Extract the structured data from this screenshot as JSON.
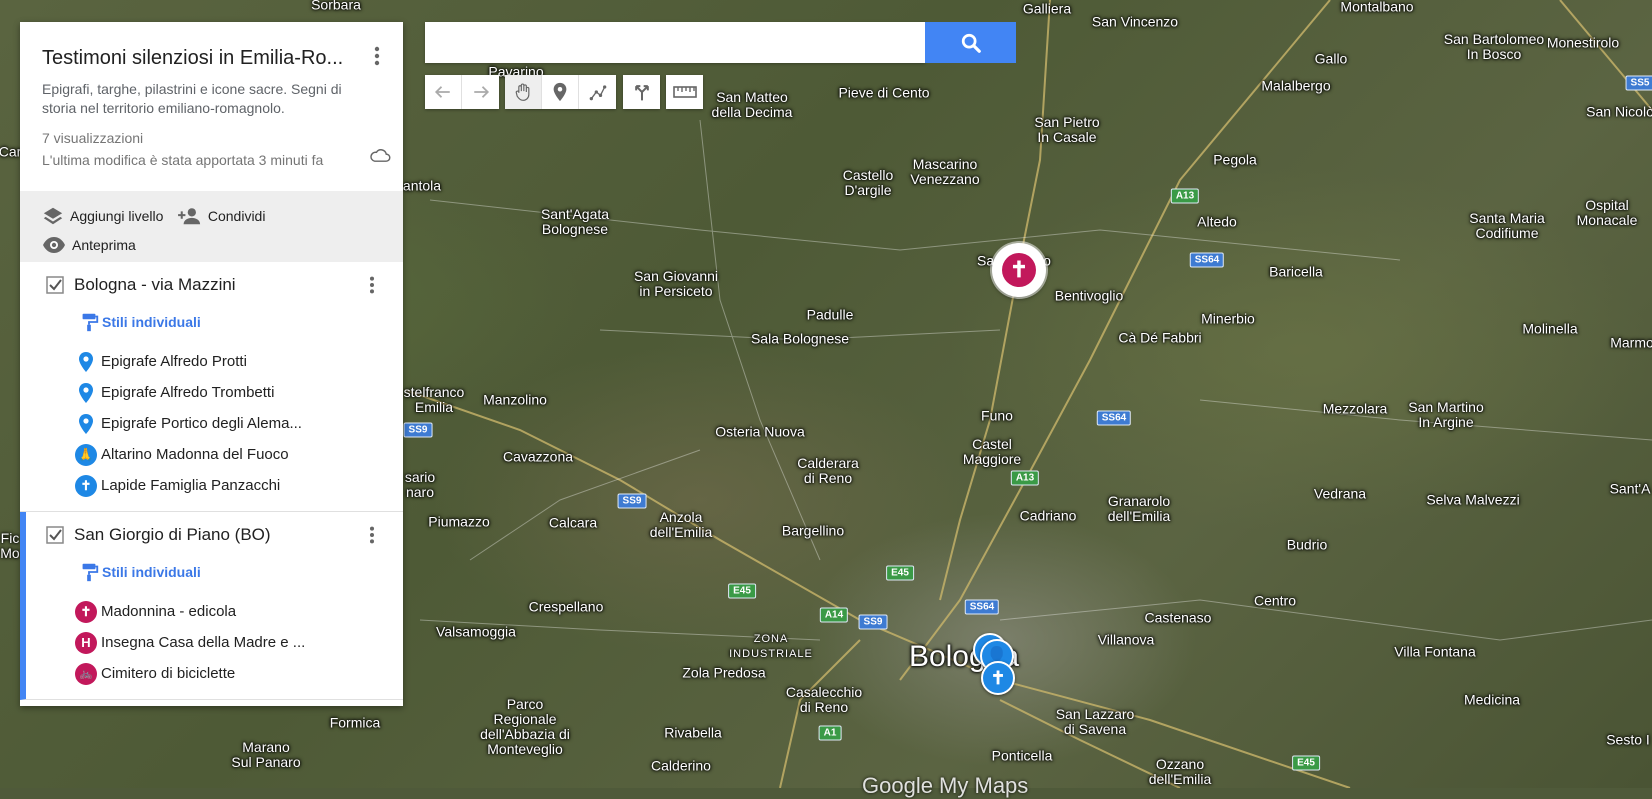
{
  "search": {
    "placeholder": "",
    "value": ""
  },
  "panel": {
    "title": "Testimoni silenziosi in Emilia-Ro...",
    "description": "Epigrafi, targhe, pilastrini e icone sacre. Segni di storia nel territorio emiliano-romagnolo.",
    "views": "7 visualizzazioni",
    "last_edit": "L'ultima modifica è stata apportata 3 minuti fa",
    "actions": {
      "add_layer": "Aggiungi livello",
      "share": "Condividi",
      "preview": "Anteprima"
    }
  },
  "layers": [
    {
      "name": "Bologna - via Mazzini",
      "styles_label": "Stili individuali",
      "features": [
        {
          "label": "Epigrafe Alfredo Protti",
          "icon": "pin-icon"
        },
        {
          "label": "Epigrafe Alfredo Trombetti",
          "icon": "pin-icon"
        },
        {
          "label": "Epigrafe Portico degli Alema...",
          "icon": "pin-icon"
        },
        {
          "label": "Altarino Madonna del Fuoco",
          "icon": "praying-icon"
        },
        {
          "label": "Lapide Famiglia Panzacchi",
          "icon": "cross-icon"
        }
      ]
    },
    {
      "name": "San Giorgio di Piano (BO)",
      "styles_label": "Stili individuali",
      "features": [
        {
          "label": "Madonnina - edicola",
          "icon": "cross-icon"
        },
        {
          "label": "Insegna Casa della Madre e ...",
          "icon": "h-icon"
        },
        {
          "label": "Cimitero di biciclette",
          "icon": "bicycle-icon"
        }
      ]
    }
  ],
  "map": {
    "places": [
      {
        "name": "Sorbara"
      },
      {
        "name": "Galliera"
      },
      {
        "name": "San Vincenzo"
      },
      {
        "name": "Montalbano"
      },
      {
        "name": "San Bartolomeo\nIn Bosco"
      },
      {
        "name": "Monestirolo"
      },
      {
        "name": "Gallo"
      },
      {
        "name": "Malalbergo"
      },
      {
        "name": "San Nicolò"
      },
      {
        "name": "Pavarino"
      },
      {
        "name": "San Matteo\ndella Decima"
      },
      {
        "name": "Pieve di Cento"
      },
      {
        "name": "San Pietro\nIn Casale"
      },
      {
        "name": "Pegola"
      },
      {
        "name": "Castello\nD'argile"
      },
      {
        "name": "Mascarino\nVenezzano"
      },
      {
        "name": "antola"
      },
      {
        "name": "Sant'Agata\nBolognese"
      },
      {
        "name": "Altedo"
      },
      {
        "name": "Santa Maria\nCodifiume"
      },
      {
        "name": "Ospital\nMonacale"
      },
      {
        "name": "San Giovanni\nin Persiceto"
      },
      {
        "name": "San Giorgio"
      },
      {
        "name": "Baricella"
      },
      {
        "name": "Bentivoglio"
      },
      {
        "name": "Padulle"
      },
      {
        "name": "Minerbio"
      },
      {
        "name": "Sala Bolognese"
      },
      {
        "name": "Cà Dé Fabbri"
      },
      {
        "name": "Molinella"
      },
      {
        "name": "Marmo"
      },
      {
        "name": "stelfranco\nEmilia"
      },
      {
        "name": "Manzolino"
      },
      {
        "name": "Funo"
      },
      {
        "name": "Osteria Nuova"
      },
      {
        "name": "Mezzolara"
      },
      {
        "name": "San Martino\nIn Argine"
      },
      {
        "name": "Castel\nMaggiore"
      },
      {
        "name": "Cavazzona"
      },
      {
        "name": "Calderara\ndi Reno"
      },
      {
        "name": "sario\nnaro"
      },
      {
        "name": "Vedrana"
      },
      {
        "name": "Selva Malvezzi"
      },
      {
        "name": "Sant'A"
      },
      {
        "name": "Granarolo\ndell'Emilia"
      },
      {
        "name": "Piumazzo"
      },
      {
        "name": "Calcara"
      },
      {
        "name": "Anzola\ndell'Emilia"
      },
      {
        "name": "Cadriano"
      },
      {
        "name": "Bargellino"
      },
      {
        "name": "Budrio"
      },
      {
        "name": "Crespellano"
      },
      {
        "name": "Centro"
      },
      {
        "name": "Castenaso"
      },
      {
        "name": "Valsamoggia"
      },
      {
        "name": "ZONA\nINDUSTRIALE"
      },
      {
        "name": "Bologna"
      },
      {
        "name": "Villanova"
      },
      {
        "name": "Zola Predosa"
      },
      {
        "name": "Villa Fontana"
      },
      {
        "name": "Casalecchio\ndi Reno"
      },
      {
        "name": "Parco\nRegionale\ndell'Abbazia di\nMonteveglio"
      },
      {
        "name": "Rivabella"
      },
      {
        "name": "San Lazzaro\ndi Savena"
      },
      {
        "name": "Medicina"
      },
      {
        "name": "Formica"
      },
      {
        "name": "Marano\nSul Panaro"
      },
      {
        "name": "Calderino"
      },
      {
        "name": "Ponticella"
      },
      {
        "name": "Ozzano\ndell'Emilia"
      },
      {
        "name": "Sesto I"
      },
      {
        "name": "Car"
      },
      {
        "name": "Fic\nMo"
      }
    ],
    "shields": [
      {
        "label": "SS5"
      },
      {
        "label": "A13"
      },
      {
        "label": "SS64"
      },
      {
        "label": "SS64"
      },
      {
        "label": "SS9"
      },
      {
        "label": "SS9"
      },
      {
        "label": "A13"
      },
      {
        "label": "E45"
      },
      {
        "label": "E45"
      },
      {
        "label": "SS64"
      },
      {
        "label": "A14"
      },
      {
        "label": "SS9"
      },
      {
        "label": "A1"
      },
      {
        "label": "E45"
      }
    ],
    "attribution": "Google My Maps"
  },
  "colors": {
    "accent": "#4285f4",
    "link": "#3b78e7",
    "pin_blue": "#1e88e5",
    "pin_pink": "#c2185b"
  }
}
